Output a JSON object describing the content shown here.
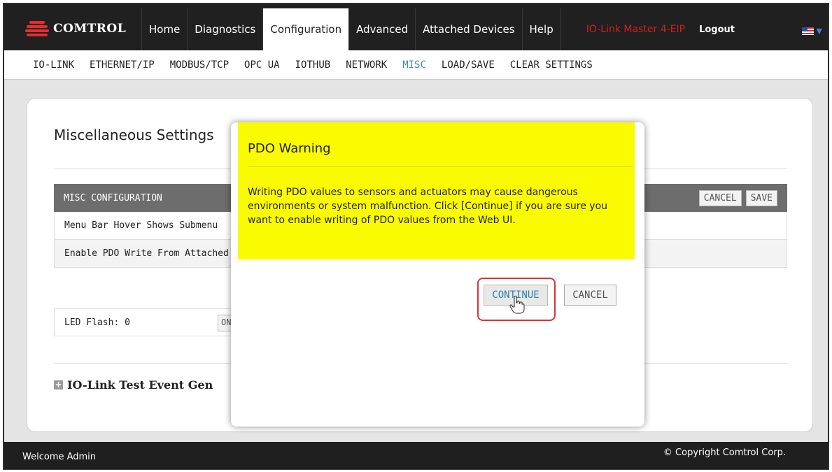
{
  "brand": {
    "logo_text": "COMTROL"
  },
  "nav": {
    "items": [
      "Home",
      "Diagnostics",
      "Configuration",
      "Advanced",
      "Attached Devices",
      "Help"
    ],
    "active": "Configuration",
    "device_name": "IO-Link Master 4-EIP",
    "logout": "Logout"
  },
  "subnav": {
    "items": [
      "IO-LINK",
      "ETHERNET/IP",
      "MODBUS/TCP",
      "OPC UA",
      "IOTHUB",
      "NETWORK",
      "MISC",
      "LOAD/SAVE",
      "CLEAR SETTINGS"
    ],
    "active": "MISC"
  },
  "page": {
    "title": "Miscellaneous Settings",
    "table": {
      "header": "MISC CONFIGURATION",
      "cancel_label": "CANCEL",
      "save_label": "SAVE",
      "rows": [
        "Menu Bar Hover Shows Submenu",
        "Enable PDO Write From Attached"
      ]
    },
    "led": {
      "label": "LED Flash: 0",
      "on_label": "ON",
      "off_label": "O"
    },
    "expander": "IO-Link Test Event Gen"
  },
  "modal": {
    "title": "PDO Warning",
    "message": "Writing PDO values to sensors and actuators may cause dangerous environments or system malfunction. Click [Continue] if you are sure you want to enable writing of PDO values from the Web UI.",
    "continue_label": "CONTINUE",
    "cancel_label": "CANCEL"
  },
  "footer": {
    "welcome": "Welcome Admin",
    "copyright": "© Copyright Comtrol Corp."
  },
  "colors": {
    "warning_bg": "#fbfb00",
    "accent": "#3a8fb0",
    "device_name": "#d21f1f",
    "highlight_ring": "#dd3333"
  }
}
